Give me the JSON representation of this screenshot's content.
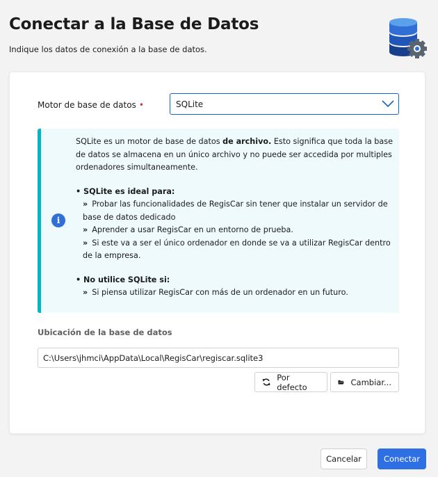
{
  "header": {
    "title": "Conectar a la Base de Datos",
    "subtitle": "Indique los datos de conexión a la base de datos."
  },
  "engine": {
    "label": "Motor de base de datos",
    "required_marker": "•",
    "selected": "SQLite"
  },
  "info": {
    "p1_a": "SQLite es un motor de base de datos ",
    "p1_b": "de archivo.",
    "p1_c": " Esto significa que toda la base de datos se almacena en un único archivo y no puede ser accedida por multiples ordenadores simultaneamente.",
    "ideal_heading": "• SQLite es ideal para:",
    "ideal_items": [
      "Probar las funcionalidades de RegisCar sin tener que instalar un servidor de base de datos dedicado",
      "Aprender a usar RegisCar en un entorno de prueba.",
      "Si este va a ser el único ordenador en donde se va a utilizar RegisCar dentro de la empresa."
    ],
    "avoid_heading": "• No utilice SQLite si:",
    "avoid_items": [
      "Si piensa utilizar RegisCar con más de un ordenador en un futuro."
    ],
    "arrow": "»"
  },
  "location": {
    "label": "Ubicación de la base de datos",
    "path": "C:\\Users\\jhmci\\AppData\\Local\\RegisCar\\regiscar.sqlite3",
    "default_button": "Por defecto",
    "change_button": "Cambiar..."
  },
  "footer": {
    "cancel": "Cancelar",
    "connect": "Conectar"
  },
  "colors": {
    "accent": "#2f6fe4",
    "info_border": "#00b7c3",
    "info_bg": "#effafc",
    "required": "#d13438"
  },
  "icons": [
    "database-settings-icon",
    "chevron-down-icon",
    "info-icon",
    "refresh-icon",
    "folder-open-icon"
  ]
}
